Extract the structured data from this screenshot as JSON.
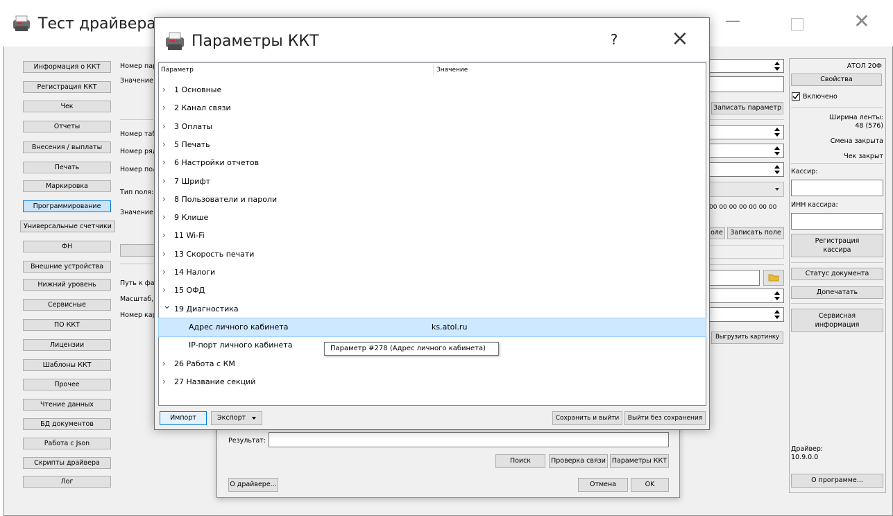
{
  "main": {
    "title": "Тест драйвера",
    "nav": [
      "Информация о ККТ",
      "Регистрация ККТ",
      "Чек",
      "Отчеты",
      "Внесения / выплаты",
      "Печать",
      "Маркировка",
      "Программирование",
      "Универсальные счетчики",
      "ФН",
      "Внешние устройства",
      "Нижний уровень",
      "Сервисные",
      "ПО ККТ",
      "Лицензии",
      "Шаблоны ККТ",
      "Прочее",
      "Чтение данных",
      "БД документов",
      "Работа с Json",
      "Скрипты драйвера",
      "Лог"
    ],
    "form_labels": [
      "Номер пар",
      "Значение",
      "Номер таб",
      "Номер ряд",
      "Номер пол",
      "Тип поля:",
      "Значение",
      "Путь к фа",
      "Масштаб,",
      "Номер кар"
    ],
    "write_param_button": "Записать параметр",
    "field_value_partial": "00 00 00 00 00 00 00",
    "field_button_partial": "оле",
    "write_field_button": "Записать поле",
    "upload_picture_button": "Выгрузить картинку"
  },
  "right_panel": {
    "device_name": "АТОЛ 20Ф",
    "properties_button": "Свойства",
    "enabled_label": "Включено",
    "tape_width_label": "Ширина ленты:",
    "tape_width_value": "48 (576)",
    "shift_status": "Смена закрыта",
    "receipt_status": "Чек закрыт",
    "cashier_label": "Кассир:",
    "cashier_inn_label": "ИНН кассира:",
    "register_cashier_button_l1": "Регистрация",
    "register_cashier_button_l2": "кассира",
    "document_status_button": "Статус документа",
    "reprint_button": "Допечатать",
    "service_info_button_l1": "Сервисная",
    "service_info_button_l2": "информация",
    "driver_label": "Драйвер:",
    "driver_version": "10.9.0.0",
    "about_button": "О программе..."
  },
  "settings_window": {
    "result_label": "Результат:",
    "search_button": "Поиск",
    "check_connection_button": "Проверка связи",
    "kkt_params_button": "Параметры ККТ",
    "about_driver_button": "О драйвере...",
    "cancel_button": "Отмена",
    "ok_button": "OK"
  },
  "dialog": {
    "title": "Параметры ККТ",
    "help_button": "?",
    "close_button": "×",
    "col_param": "Параметр",
    "col_value": "Значение",
    "items": [
      {
        "name": "1 Основные",
        "value": ""
      },
      {
        "name": "2 Канал связи",
        "value": ""
      },
      {
        "name": "3 Оплаты",
        "value": ""
      },
      {
        "name": "5 Печать",
        "value": ""
      },
      {
        "name": "6 Настройки отчетов",
        "value": ""
      },
      {
        "name": "7 Шрифт",
        "value": ""
      },
      {
        "name": "8 Пользователи и пароли",
        "value": ""
      },
      {
        "name": "9 Клише",
        "value": ""
      },
      {
        "name": "11 Wi-Fi",
        "value": ""
      },
      {
        "name": "13 Скорость печати",
        "value": ""
      },
      {
        "name": "14 Налоги",
        "value": ""
      },
      {
        "name": "15 ОФД",
        "value": ""
      },
      {
        "name": "19 Диагностика",
        "value": ""
      },
      {
        "name": "Адрес личного кабинета",
        "value": "ks.atol.ru"
      },
      {
        "name": "IP-порт личного кабинета",
        "value": ""
      },
      {
        "name": "26 Работа с КМ",
        "value": ""
      },
      {
        "name": "27 Название секций",
        "value": ""
      }
    ],
    "tooltip": "Параметр #278 (Адрес личного кабинета)",
    "import_button": "Импорт",
    "export_button": "Экспорт",
    "save_exit_button": "Сохранить и выйти",
    "exit_no_save_button": "Выйти без сохранения"
  }
}
